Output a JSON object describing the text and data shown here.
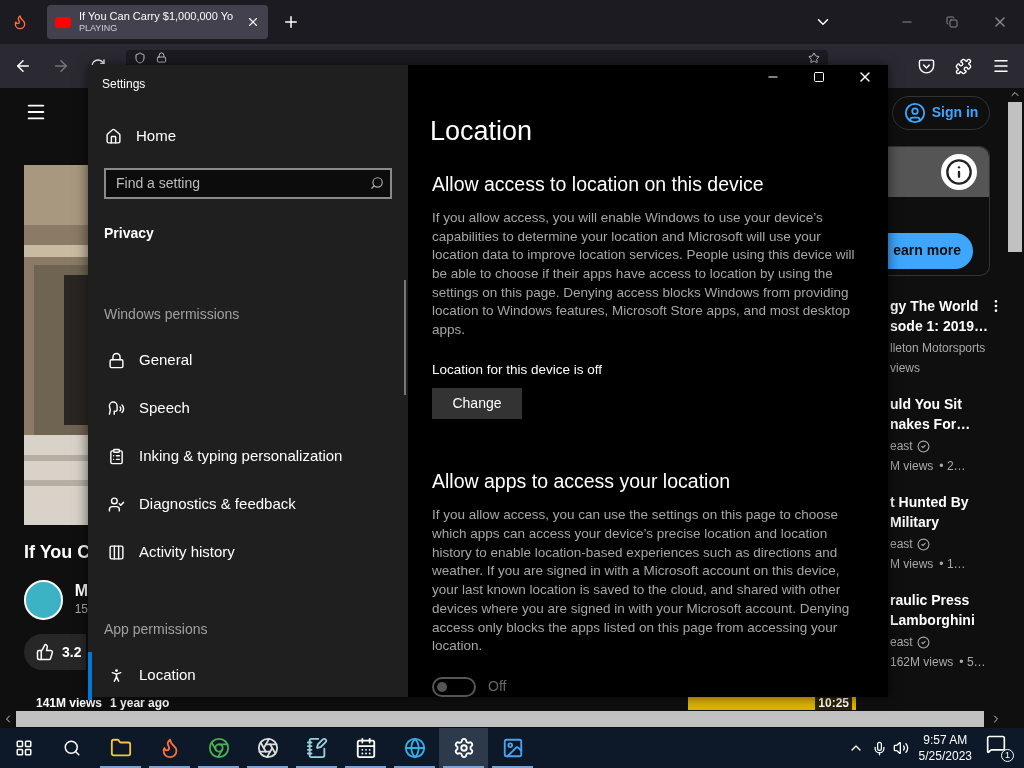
{
  "browser": {
    "tab": {
      "title": "If You Can Carry $1,000,000 Yo",
      "status": "PLAYING",
      "selected": true
    }
  },
  "youtube": {
    "left": {
      "title": "If You C",
      "channel": "M",
      "subs": "15",
      "likes": "3.2",
      "views": "141M views",
      "age": "1 year ago"
    },
    "sign_in": "Sign in",
    "ad_button": "earn more",
    "thumb_duration": "10:25",
    "videos": [
      {
        "title": [
          "gy The World",
          "sode 1: 2019…"
        ],
        "channel": "lleton Motorsports",
        "verified": false,
        "views": "views"
      },
      {
        "title": [
          "uld You Sit",
          "nakes For…"
        ],
        "channel": "east",
        "verified": true,
        "views": "M views",
        "age": "• 2…"
      },
      {
        "title": [
          "t Hunted By",
          "Military"
        ],
        "channel": "east",
        "verified": true,
        "views": "M views",
        "age": "• 1…"
      },
      {
        "title": [
          "raulic Press",
          "Lamborghini"
        ],
        "channel": "east",
        "verified": true,
        "views": "162M views",
        "age": "• 5…"
      }
    ]
  },
  "settings": {
    "title": "Settings",
    "home": "Home",
    "search": {
      "placeholder": "Find a setting"
    },
    "section": "Privacy",
    "groups": [
      {
        "label": "Windows permissions",
        "items": [
          {
            "label": "General",
            "kind": "lock",
            "selected": false
          },
          {
            "label": "Speech",
            "kind": "speech",
            "selected": false
          },
          {
            "label": "Inking & typing personalization",
            "kind": "clipboard",
            "selected": false
          },
          {
            "label": "Diagnostics & feedback",
            "kind": "feedback",
            "selected": false
          },
          {
            "label": "Activity history",
            "kind": "activity",
            "selected": false
          }
        ]
      },
      {
        "label": "App permissions",
        "items": [
          {
            "label": "Location",
            "kind": "location",
            "selected": true
          }
        ]
      }
    ],
    "page": {
      "title": "Location",
      "sections": [
        {
          "heading": "Allow access to location on this device",
          "text": "If you allow access, you will enable Windows to use your device’s capabilities to determine your location and Microsoft will use your location data to improve location services. People using this device will be able to choose if their apps have access to location by using the settings on this page. Denying access blocks Windows from providing location to Windows features, Microsoft Store apps, and most desktop apps.",
          "status": "Location for this device is off",
          "button": "Change"
        },
        {
          "heading": "Allow apps to access your location",
          "text": "If you allow access, you can use the settings on this page to choose which apps can access your device’s precise location and location history to enable location-based experiences such as directions and weather. If you are signed in with a Microsoft account on this device, your last known location is saved to the cloud, and shared with other devices where you are signed in with your Microsoft account. Denying access only blocks the apps listed on this page from accessing your location.",
          "toggle": {
            "on": false,
            "label": "Off"
          }
        }
      ]
    }
  },
  "taskbar": {
    "apps": [
      {
        "kind": "explorer",
        "running": true,
        "selected": false
      },
      {
        "kind": "firefox",
        "running": true,
        "selected": false
      },
      {
        "kind": "chrome",
        "running": true,
        "selected": false
      },
      {
        "kind": "obs",
        "running": true,
        "selected": false
      },
      {
        "kind": "notes",
        "running": true,
        "selected": false
      },
      {
        "kind": "calendar",
        "running": true,
        "selected": false
      },
      {
        "kind": "edge",
        "running": true,
        "selected": false
      },
      {
        "kind": "settings",
        "running": true,
        "selected": true
      },
      {
        "kind": "photos",
        "running": true,
        "selected": false
      }
    ],
    "time": "9:57 AM",
    "date": "5/25/2023",
    "notifications": "1"
  }
}
